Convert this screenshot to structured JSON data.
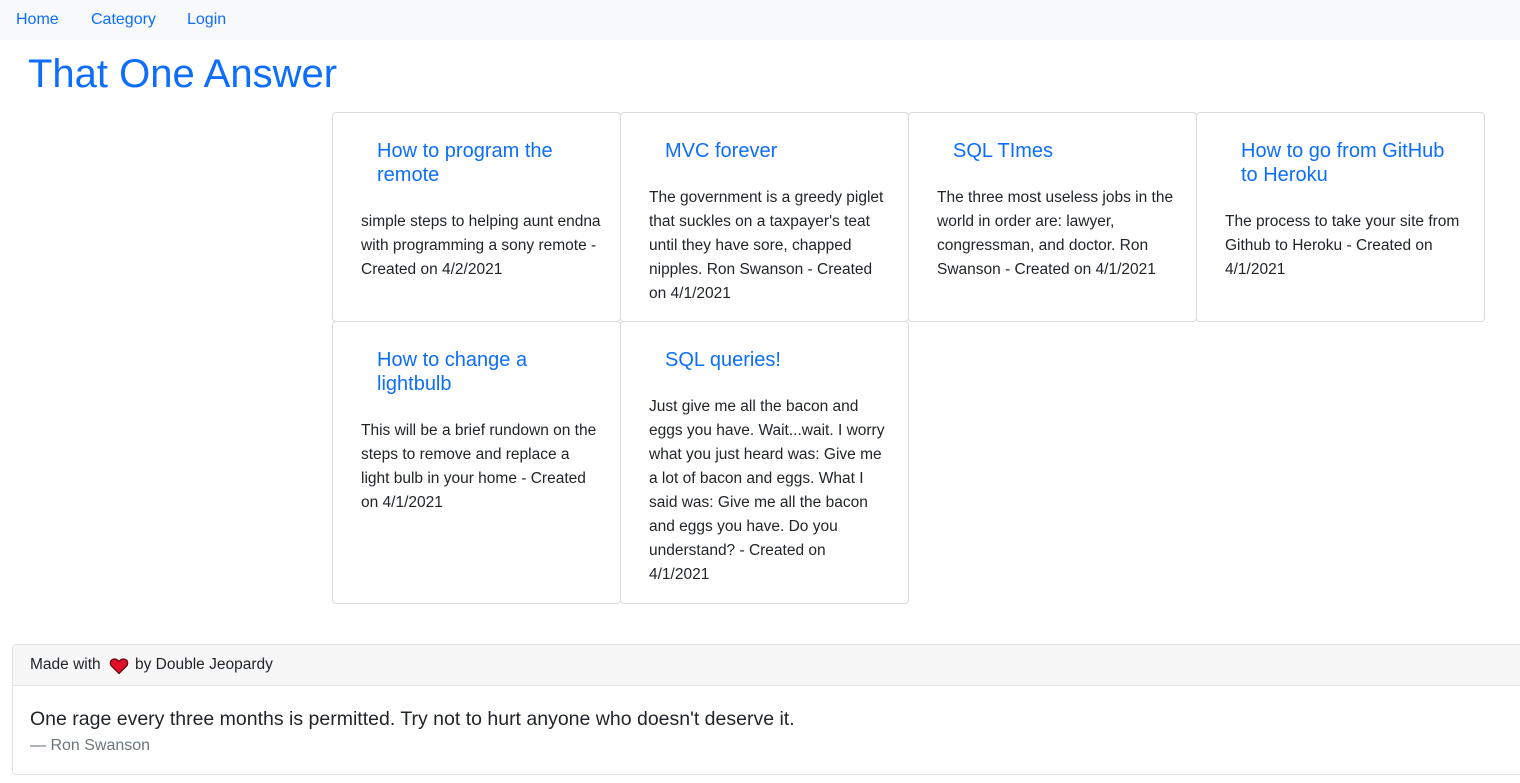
{
  "nav": {
    "items": [
      {
        "label": "Home"
      },
      {
        "label": "Category"
      },
      {
        "label": "Login"
      }
    ]
  },
  "site": {
    "title": "That One Answer"
  },
  "cards": [
    {
      "title": "How to program the remote",
      "text": "simple steps to helping aunt endna with programming a sony remote - Created on 4/2/2021"
    },
    {
      "title": "MVC forever",
      "text": "The government is a greedy piglet that suckles on a taxpayer's teat until they have sore, chapped nipples. Ron Swanson - Created on 4/1/2021"
    },
    {
      "title": "SQL TImes",
      "text": "The three most useless jobs in the world in order are: lawyer, congressman, and doctor. Ron Swanson - Created on 4/1/2021"
    },
    {
      "title": "How to go from GitHub to Heroku",
      "text": "The process to take your site from Github to Heroku - Created on 4/1/2021"
    },
    {
      "title": "How to change a lightbulb",
      "text": "This will be a brief rundown on the steps to remove and replace a light bulb in your home - Created on 4/1/2021"
    },
    {
      "title": "SQL queries!",
      "text": "Just give me all the bacon and eggs you have. Wait...wait. I worry what you just heard was: Give me a lot of bacon and eggs. What I said was: Give me all the bacon and eggs you have. Do you understand? - Created on 4/1/2021"
    }
  ],
  "footer": {
    "made_with": "Made with",
    "by": "by Double Jeopardy",
    "heart_icon": "heart-icon",
    "heart_color": "#e0102a",
    "quote": "One rage every three months is permitted. Try not to hurt anyone who doesn't deserve it.",
    "author": "— Ron Swanson"
  }
}
